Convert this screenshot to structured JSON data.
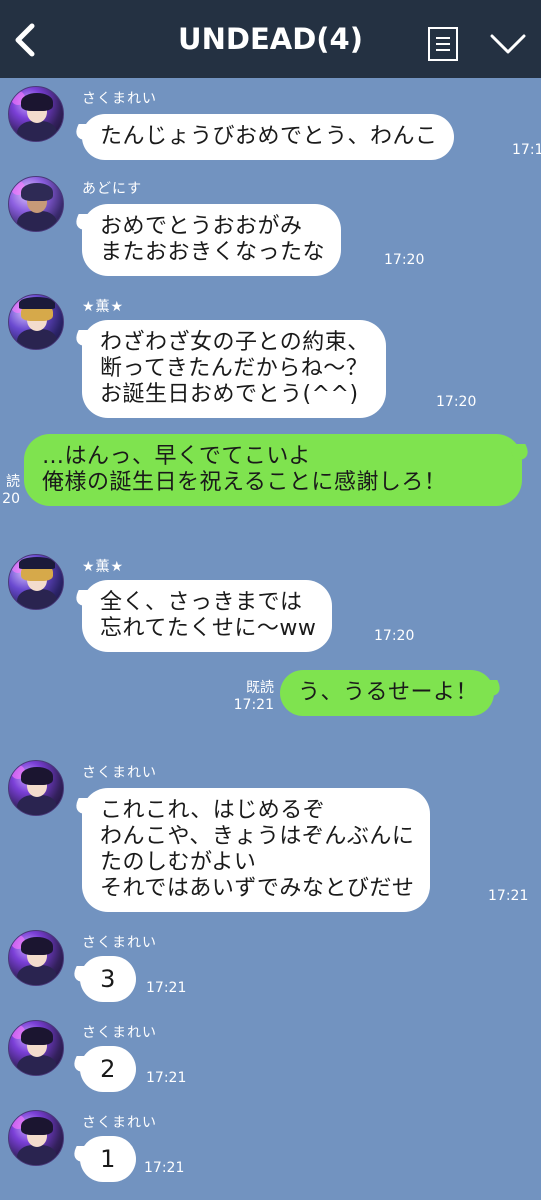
{
  "header": {
    "title": "UNDEAD(4)",
    "back_icon": "chevron-left-icon",
    "menu_icon": "note-list-icon",
    "collapse_icon": "chevron-down-icon",
    "background": "#243142"
  },
  "chat": {
    "background": "#7293c0",
    "incoming_bubble_color": "#ffffff",
    "outgoing_bubble_color": "#7fe34f",
    "messages": [
      {
        "sender": "さくまれい",
        "text": "たんじょうびおめでとう、わんこ",
        "time": "17:1"
      },
      {
        "sender": "あどにす",
        "text": "おめでとうおおがみ\nまたおおきくなったな",
        "time": "17:20"
      },
      {
        "sender": "★薫★",
        "text": "わざわざ女の子との約束、\n断ってきたんだからね〜？\nお誕生日おめでとう(^^)",
        "time": "17:20"
      },
      {
        "sender": "",
        "text": "…はんっ、早くでてこいよ\n俺様の誕生日を祝えることに感謝しろ！",
        "read": "読",
        "time": "20"
      },
      {
        "sender": "★薫★",
        "text": "全く、さっきまでは\n忘れてたくせに〜ww",
        "time": "17:20"
      },
      {
        "sender": "",
        "text": "う、うるせーよ！",
        "read": "既読",
        "time": "17:21"
      },
      {
        "sender": "さくまれい",
        "text": "これこれ、はじめるぞ\nわんこや、きょうはぞんぶんに\nたのしむがよい\nそれではあいずでみなとびだせ",
        "time": "17:21"
      },
      {
        "sender": "さくまれい",
        "text": "3",
        "time": "17:21"
      },
      {
        "sender": "さくまれい",
        "text": "2",
        "time": "17:21"
      },
      {
        "sender": "さくまれい",
        "text": "1",
        "time": "17:21"
      }
    ]
  }
}
